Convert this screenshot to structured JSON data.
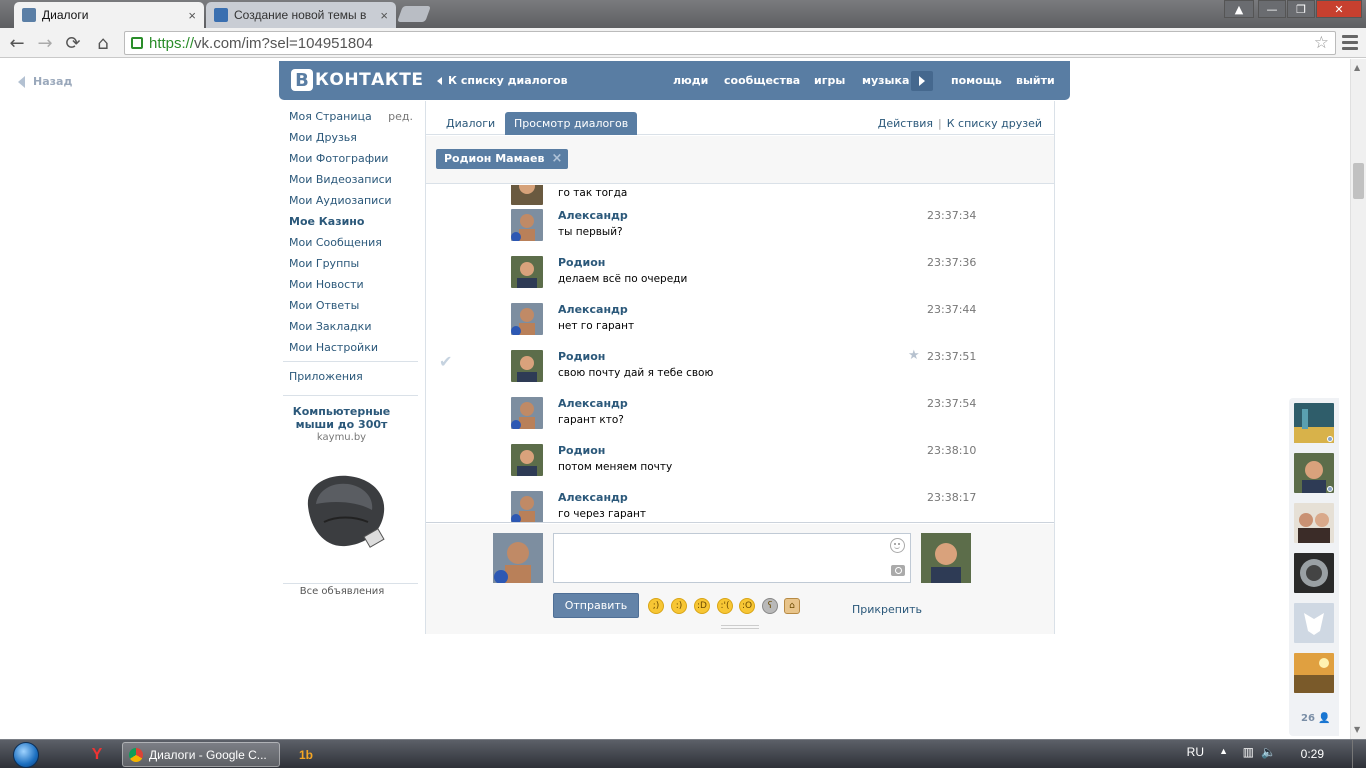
{
  "browser": {
    "tabs": [
      {
        "title": "Диалоги",
        "active": true
      },
      {
        "title": "Создание новой темы в",
        "active": false
      }
    ],
    "url_scheme": "https://",
    "url_rest": "vk.com/im?sel=104951804",
    "close_glyph": "×"
  },
  "page": {
    "back_label": "Назад",
    "logo_letter": "В",
    "logo_text": "КОНТАКТЕ",
    "header": {
      "to_dialogs": "К списку диалогов",
      "nav": [
        "люди",
        "сообщества",
        "игры",
        "музыка",
        "помощь",
        "выйти"
      ]
    },
    "left_menu": [
      {
        "label": "Моя Страница",
        "edit": "ред."
      },
      {
        "label": "Мои Друзья"
      },
      {
        "label": "Мои Фотографии"
      },
      {
        "label": "Мои Видеозаписи"
      },
      {
        "label": "Мои Аудиозаписи"
      },
      {
        "label": "Мое Казино",
        "bold": true
      },
      {
        "label": "Мои Сообщения"
      },
      {
        "label": "Мои Группы"
      },
      {
        "label": "Мои Новости"
      },
      {
        "label": "Мои Ответы"
      },
      {
        "label": "Мои Закладки"
      },
      {
        "label": "Мои Настройки"
      }
    ],
    "apps_label": "Приложения",
    "ad": {
      "title": "Компьютерные мыши до 300т",
      "domain": "kaymu.by",
      "all_ads": "Все объявления"
    },
    "tabs": [
      {
        "label": "Диалоги",
        "selected": false
      },
      {
        "label": "Просмотр диалогов",
        "selected": true
      }
    ],
    "actions_label": "Действия",
    "friends_list_label": "К списку друзей",
    "peer_name": "Родион Мамаев",
    "peer_close": "×",
    "partial_message": "го так тогда",
    "messages": [
      {
        "author": "Александр",
        "text": "ты первый?",
        "time": "23:37:34",
        "who": "a"
      },
      {
        "author": "Родион",
        "text": "делаем всё по очереди",
        "time": "23:37:36",
        "who": "r"
      },
      {
        "author": "Александр",
        "text": "нет го гарант",
        "time": "23:37:44",
        "who": "a"
      },
      {
        "author": "Родион",
        "text": "свою почту дай я тебе свою",
        "time": "23:37:51",
        "who": "r",
        "starred": true,
        "checked": true
      },
      {
        "author": "Александр",
        "text": "гарант кто?",
        "time": "23:37:54",
        "who": "a"
      },
      {
        "author": "Родион",
        "text": "потом меняем почту",
        "time": "23:38:10",
        "who": "r"
      },
      {
        "author": "Александр",
        "text": "го через гарант",
        "time": "23:38:17",
        "who": "a"
      }
    ],
    "compose": {
      "input_value": "",
      "send_label": "Отправить",
      "attach_label": "Прикрепить",
      "emoji_count": 7
    },
    "friends_count": "26"
  },
  "taskbar": {
    "window_label": "Диалоги - Google C...",
    "lang": "RU",
    "clock": "0:29"
  },
  "colors": {
    "vk_blue": "#597da3",
    "link": "#2b587a"
  }
}
